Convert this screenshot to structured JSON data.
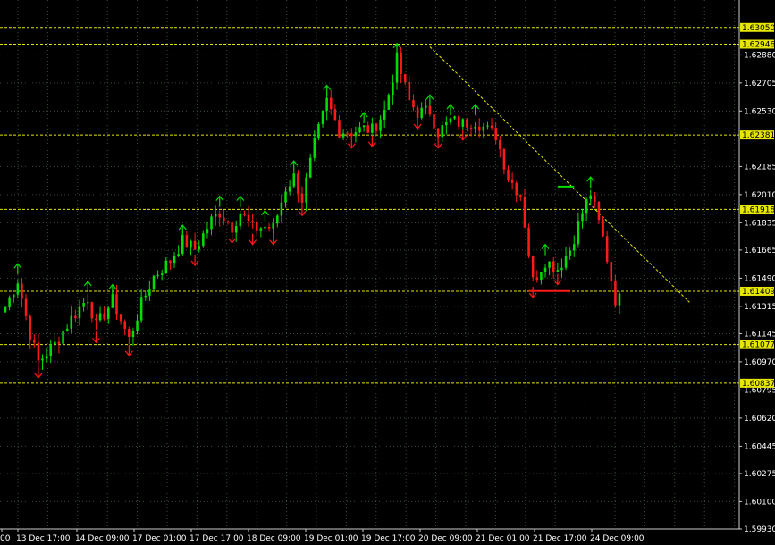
{
  "chart_data": {
    "type": "candlestick",
    "y_range": [
      1.5993,
      1.6321
    ],
    "y_ticks": [
      "1.62880",
      "1.62705",
      "1.62530",
      "1.62185",
      "1.62010",
      "1.61835",
      "1.61665",
      "1.61490",
      "1.61315",
      "1.61145",
      "1.60970",
      "1.60795",
      "1.60620",
      "1.60445",
      "1.60275",
      "1.60100",
      "1.59930"
    ],
    "x_labels": [
      "00",
      "13 Dec 17:00",
      "14 Dec 09:00",
      "17 Dec 01:00",
      "17 Dec 17:00",
      "18 Dec 09:00",
      "19 Dec 01:00",
      "19 Dec 17:00",
      "20 Dec 09:00",
      "21 Dec 01:00",
      "21 Dec 17:00",
      "24 Dec 09:00"
    ],
    "horizontal_levels": [
      {
        "label": "1.63050",
        "value": 1.6305
      },
      {
        "label": "1.62946",
        "value": 1.62946
      },
      {
        "label": "1.62381",
        "value": 1.62381
      },
      {
        "label": "1.61918",
        "value": 1.61918
      },
      {
        "label": "1.61409",
        "value": 1.61409
      },
      {
        "label": "1.61077",
        "value": 1.61077
      },
      {
        "label": "1.60837",
        "value": 1.60837
      }
    ],
    "grid": "on",
    "up_color": "#00dd00",
    "down_color": "#ff1a1a",
    "level_color": "#e6e600",
    "trendline": {
      "from_bar": 103,
      "from_value": 1.6293,
      "to_bar": 166,
      "to_value": 1.6134
    },
    "short_levels": [
      {
        "start_bar": 134,
        "end_bar": 138,
        "value": 1.6206,
        "color": "#00dd00"
      },
      {
        "start_bar": 127,
        "end_bar": 137,
        "value": 1.6141,
        "color": "#ff1a1a"
      }
    ],
    "anchors": [
      [
        0,
        1.6131
      ],
      [
        3,
        1.6148
      ],
      [
        6,
        1.6114
      ],
      [
        8,
        1.6097
      ],
      [
        12,
        1.6108
      ],
      [
        16,
        1.6124
      ],
      [
        20,
        1.6137
      ],
      [
        22,
        1.6119
      ],
      [
        26,
        1.6135
      ],
      [
        30,
        1.6111
      ],
      [
        33,
        1.6133
      ],
      [
        36,
        1.615
      ],
      [
        40,
        1.616
      ],
      [
        43,
        1.6172
      ],
      [
        46,
        1.6167
      ],
      [
        50,
        1.6185
      ],
      [
        52,
        1.619
      ],
      [
        55,
        1.6181
      ],
      [
        57,
        1.619
      ],
      [
        60,
        1.618
      ],
      [
        63,
        1.6181
      ],
      [
        65,
        1.618
      ],
      [
        68,
        1.6205
      ],
      [
        70,
        1.6212
      ],
      [
        72,
        1.6198
      ],
      [
        75,
        1.6232
      ],
      [
        78,
        1.6259
      ],
      [
        81,
        1.6241
      ],
      [
        84,
        1.624
      ],
      [
        87,
        1.6242
      ],
      [
        89,
        1.6241
      ],
      [
        92,
        1.6253
      ],
      [
        95,
        1.6285
      ],
      [
        98,
        1.6259
      ],
      [
        100,
        1.6252
      ],
      [
        103,
        1.6253
      ],
      [
        105,
        1.624
      ],
      [
        108,
        1.6247
      ],
      [
        111,
        1.6245
      ],
      [
        114,
        1.6247
      ],
      [
        117,
        1.6241
      ],
      [
        119,
        1.6238
      ],
      [
        122,
        1.6212
      ],
      [
        125,
        1.6201
      ],
      [
        128,
        1.6147
      ],
      [
        131,
        1.616
      ],
      [
        134,
        1.6155
      ],
      [
        137,
        1.6167
      ],
      [
        140,
        1.619
      ],
      [
        142,
        1.6202
      ],
      [
        145,
        1.6174
      ],
      [
        148,
        1.6136
      ]
    ],
    "total_bars": 150
  }
}
